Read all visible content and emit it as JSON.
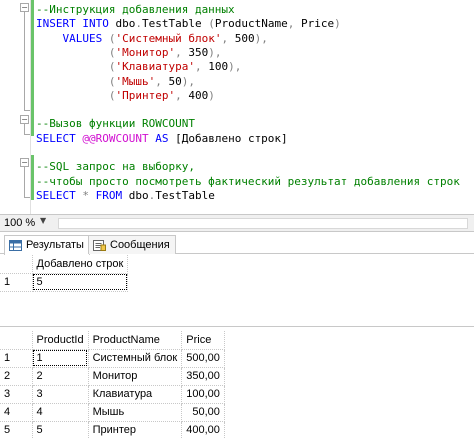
{
  "editor": {
    "lines": [
      {
        "parts": [
          {
            "t": "--Инструкция добавления данных",
            "c": "cm"
          }
        ]
      },
      {
        "parts": [
          {
            "t": "INSERT INTO ",
            "c": "kw"
          },
          {
            "t": "dbo",
            "c": ""
          },
          {
            "t": ".",
            "c": "gray"
          },
          {
            "t": "TestTable ",
            "c": ""
          },
          {
            "t": "(",
            "c": "gray"
          },
          {
            "t": "ProductName",
            "c": ""
          },
          {
            "t": ", ",
            "c": "gray"
          },
          {
            "t": "Price",
            "c": ""
          },
          {
            "t": ")",
            "c": "gray"
          }
        ]
      },
      {
        "parts": [
          {
            "t": "    VALUES ",
            "c": "kw"
          },
          {
            "t": "(",
            "c": "gray"
          },
          {
            "t": "'Системный блок'",
            "c": "str"
          },
          {
            "t": ", ",
            "c": "gray"
          },
          {
            "t": "500",
            "c": ""
          },
          {
            "t": "),",
            "c": "gray"
          }
        ]
      },
      {
        "parts": [
          {
            "t": "           (",
            "c": "gray"
          },
          {
            "t": "'Монитор'",
            "c": "str"
          },
          {
            "t": ", ",
            "c": "gray"
          },
          {
            "t": "350",
            "c": ""
          },
          {
            "t": "),",
            "c": "gray"
          }
        ]
      },
      {
        "parts": [
          {
            "t": "           (",
            "c": "gray"
          },
          {
            "t": "'Клавиатура'",
            "c": "str"
          },
          {
            "t": ", ",
            "c": "gray"
          },
          {
            "t": "100",
            "c": ""
          },
          {
            "t": "),",
            "c": "gray"
          }
        ]
      },
      {
        "parts": [
          {
            "t": "           (",
            "c": "gray"
          },
          {
            "t": "'Мышь'",
            "c": "str"
          },
          {
            "t": ", ",
            "c": "gray"
          },
          {
            "t": "50",
            "c": ""
          },
          {
            "t": "),",
            "c": "gray"
          }
        ]
      },
      {
        "parts": [
          {
            "t": "           (",
            "c": "gray"
          },
          {
            "t": "'Принтер'",
            "c": "str"
          },
          {
            "t": ", ",
            "c": "gray"
          },
          {
            "t": "400",
            "c": ""
          },
          {
            "t": ")",
            "c": "gray"
          }
        ]
      },
      {
        "parts": []
      },
      {
        "parts": [
          {
            "t": "--Вызов функции ROWCOUNT",
            "c": "cm"
          }
        ]
      },
      {
        "parts": [
          {
            "t": "SELECT ",
            "c": "kw"
          },
          {
            "t": "@@ROWCOUNT",
            "c": "fn"
          },
          {
            "t": " AS ",
            "c": "kw"
          },
          {
            "t": "[Добавлено строк]",
            "c": ""
          }
        ]
      },
      {
        "parts": []
      },
      {
        "parts": [
          {
            "t": "--SQL запрос на выборку,",
            "c": "cm"
          }
        ]
      },
      {
        "parts": [
          {
            "t": "--чтобы просто посмотреть фактический результат добавления строк",
            "c": "cm"
          }
        ]
      },
      {
        "parts": [
          {
            "t": "SELECT ",
            "c": "kw"
          },
          {
            "t": "* ",
            "c": "gray"
          },
          {
            "t": "FROM ",
            "c": "kw"
          },
          {
            "t": "dbo",
            "c": ""
          },
          {
            "t": ".",
            "c": "gray"
          },
          {
            "t": "TestTable",
            "c": ""
          }
        ]
      }
    ]
  },
  "zoom": {
    "value": "100 %"
  },
  "tabs": [
    {
      "label": "Результаты",
      "icon": "grid-icon",
      "active": true
    },
    {
      "label": "Сообщения",
      "icon": "messages-icon",
      "active": false
    }
  ],
  "grid1": {
    "columns": [
      "Добавлено строк"
    ],
    "rows": [
      {
        "num": "1",
        "cells": [
          "5"
        ]
      }
    ]
  },
  "grid2": {
    "columns": [
      "ProductId",
      "ProductName",
      "Price"
    ],
    "rows": [
      {
        "num": "1",
        "cells": [
          "1",
          "Системный блок",
          "500,00"
        ]
      },
      {
        "num": "2",
        "cells": [
          "2",
          "Монитор",
          "350,00"
        ]
      },
      {
        "num": "3",
        "cells": [
          "3",
          "Клавиатура",
          "100,00"
        ]
      },
      {
        "num": "4",
        "cells": [
          "4",
          "Мышь",
          "50,00"
        ]
      },
      {
        "num": "5",
        "cells": [
          "5",
          "Принтер",
          "400,00"
        ]
      }
    ]
  }
}
